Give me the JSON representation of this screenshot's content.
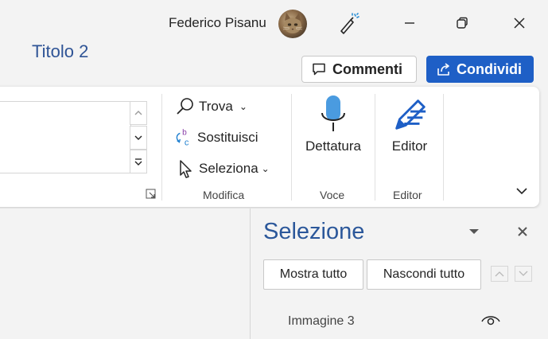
{
  "titlebar": {
    "user_name": "Federico Pisanu",
    "icons": [
      "avatar",
      "magic-wand-icon",
      "minimize-icon",
      "restore-icon",
      "close-icon"
    ]
  },
  "commands": {
    "comments_label": "Commenti",
    "share_label": "Condividi"
  },
  "ribbon": {
    "styles": {
      "current_style": "Titolo 2"
    },
    "modifica": {
      "find_label": "Trova",
      "replace_label": "Sostituisci",
      "select_label": "Seleziona",
      "group_label": "Modifica"
    },
    "voce": {
      "dictation_label": "Dettatura",
      "group_label": "Voce"
    },
    "editor": {
      "editor_label": "Editor",
      "group_label": "Editor"
    }
  },
  "selection_pane": {
    "title": "Selezione",
    "show_all_label": "Mostra tutto",
    "hide_all_label": "Nascondi tutto",
    "items": [
      {
        "name": "Immagine 3",
        "visible": true
      }
    ]
  },
  "colors": {
    "accent_blue": "#1e5fc6",
    "pane_title": "#2b579a",
    "style_title": "#2f5496"
  }
}
